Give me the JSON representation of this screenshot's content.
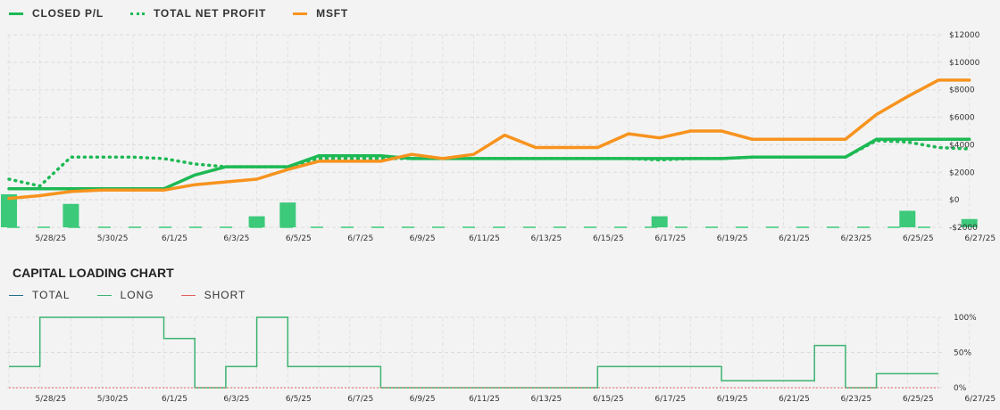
{
  "legend_top": [
    {
      "label": "CLOSED P/L",
      "color": "#1db954",
      "style": "solid"
    },
    {
      "label": "TOTAL NET PROFIT",
      "color": "#1db954",
      "style": "dotted"
    },
    {
      "label": "MSFT",
      "color": "#f7931e",
      "style": "solid"
    }
  ],
  "capital_title": "CAPITAL LOADING CHART",
  "legend_bottom": [
    {
      "label": "TOTAL",
      "color": "#1f6f8b"
    },
    {
      "label": "LONG",
      "color": "#3cb371"
    },
    {
      "label": "SHORT",
      "color": "#e06060"
    }
  ],
  "chart_data": [
    {
      "type": "line",
      "x": [
        "5/27/25",
        "5/28/25",
        "5/29/25",
        "5/30/25",
        "5/31/25",
        "6/1/25",
        "6/2/25",
        "6/3/25",
        "6/4/25",
        "6/5/25",
        "6/6/25",
        "6/7/25",
        "6/8/25",
        "6/9/25",
        "6/10/25",
        "6/11/25",
        "6/12/25",
        "6/13/25",
        "6/14/25",
        "6/15/25",
        "6/16/25",
        "6/17/25",
        "6/18/25",
        "6/19/25",
        "6/20/25",
        "6/21/25",
        "6/22/25",
        "6/23/25",
        "6/24/25",
        "6/25/25",
        "6/26/25",
        "6/27/25"
      ],
      "x_tick_labels": [
        "5/28/25",
        "5/30/25",
        "6/1/25",
        "6/3/25",
        "6/5/25",
        "6/7/25",
        "6/9/25",
        "6/11/25",
        "6/13/25",
        "6/15/25",
        "6/17/25",
        "6/19/25",
        "6/21/25",
        "6/23/25",
        "6/25/25",
        "6/27/25"
      ],
      "y_tick_labels": [
        "$12000",
        "$10000",
        "$8000",
        "$6000",
        "$4000",
        "$2000",
        "$0",
        "-$2000"
      ],
      "ylim": [
        -2000,
        12000
      ],
      "grid": true,
      "legend": "top-left",
      "series": [
        {
          "name": "CLOSED P/L",
          "style": "solid",
          "color": "#1db954",
          "values": [
            800,
            800,
            800,
            800,
            800,
            800,
            1800,
            2400,
            2400,
            2400,
            3200,
            3200,
            3200,
            3000,
            3000,
            3000,
            3000,
            3000,
            3000,
            3000,
            3000,
            3000,
            3000,
            3000,
            3100,
            3100,
            3100,
            3100,
            4400,
            4400,
            4400,
            4400
          ]
        },
        {
          "name": "TOTAL NET PROFIT",
          "style": "dotted",
          "color": "#1db954",
          "values": [
            1500,
            1000,
            3100,
            3100,
            3100,
            3000,
            2600,
            2400,
            2400,
            2400,
            3000,
            3000,
            3000,
            3000,
            3000,
            3000,
            3000,
            3000,
            3000,
            3000,
            3000,
            2900,
            3000,
            3000,
            3100,
            3100,
            3100,
            3100,
            4300,
            4200,
            3800,
            3700
          ]
        },
        {
          "name": "MSFT",
          "style": "solid",
          "color": "#f7931e",
          "values": [
            100,
            300,
            600,
            700,
            700,
            700,
            1100,
            1300,
            1500,
            2200,
            2800,
            2800,
            2800,
            3300,
            3000,
            3300,
            4700,
            3800,
            3800,
            3800,
            4800,
            4500,
            5000,
            5000,
            4400,
            4400,
            4400,
            4400,
            6200,
            7500,
            8700,
            8700
          ]
        }
      ],
      "bars": {
        "color": "#3cc97a",
        "values": [
          2400,
          0,
          1700,
          0,
          0,
          0,
          0,
          0,
          800,
          1800,
          0,
          0,
          0,
          0,
          0,
          0,
          0,
          0,
          0,
          0,
          0,
          800,
          0,
          0,
          0,
          0,
          0,
          0,
          0,
          1200,
          0,
          600
        ]
      }
    },
    {
      "type": "line",
      "x_tick_labels": [
        "5/28/25",
        "5/30/25",
        "6/1/25",
        "6/3/25",
        "6/5/25",
        "6/7/25",
        "6/9/25",
        "6/11/25",
        "6/13/25",
        "6/15/25",
        "6/17/25",
        "6/19/25",
        "6/21/25",
        "6/23/25",
        "6/25/25",
        "6/27/25"
      ],
      "y_tick_labels": [
        "100%",
        "50%",
        "0%"
      ],
      "ylim": [
        0,
        100
      ],
      "grid": true,
      "legend": "top-left",
      "series": [
        {
          "name": "LONG",
          "style": "step",
          "color": "#3cb371",
          "points": [
            [
              "5/27/25",
              30
            ],
            [
              "5/28/25",
              100
            ],
            [
              "5/31/25",
              100
            ],
            [
              "6/1/25",
              70
            ],
            [
              "6/2/25",
              0
            ],
            [
              "6/3/25",
              30
            ],
            [
              "6/4/25",
              100
            ],
            [
              "6/5/25",
              30
            ],
            [
              "6/8/25",
              0
            ],
            [
              "6/15/25",
              30
            ],
            [
              "6/19/25",
              10
            ],
            [
              "6/22/25",
              60
            ],
            [
              "6/23/25",
              0
            ],
            [
              "6/24/25",
              20
            ],
            [
              "6/26/25",
              20
            ]
          ]
        },
        {
          "name": "SHORT",
          "style": "dashed",
          "color": "#e06060",
          "points": [
            [
              "5/27/25",
              0
            ],
            [
              "6/26/25",
              0
            ]
          ]
        }
      ]
    }
  ]
}
